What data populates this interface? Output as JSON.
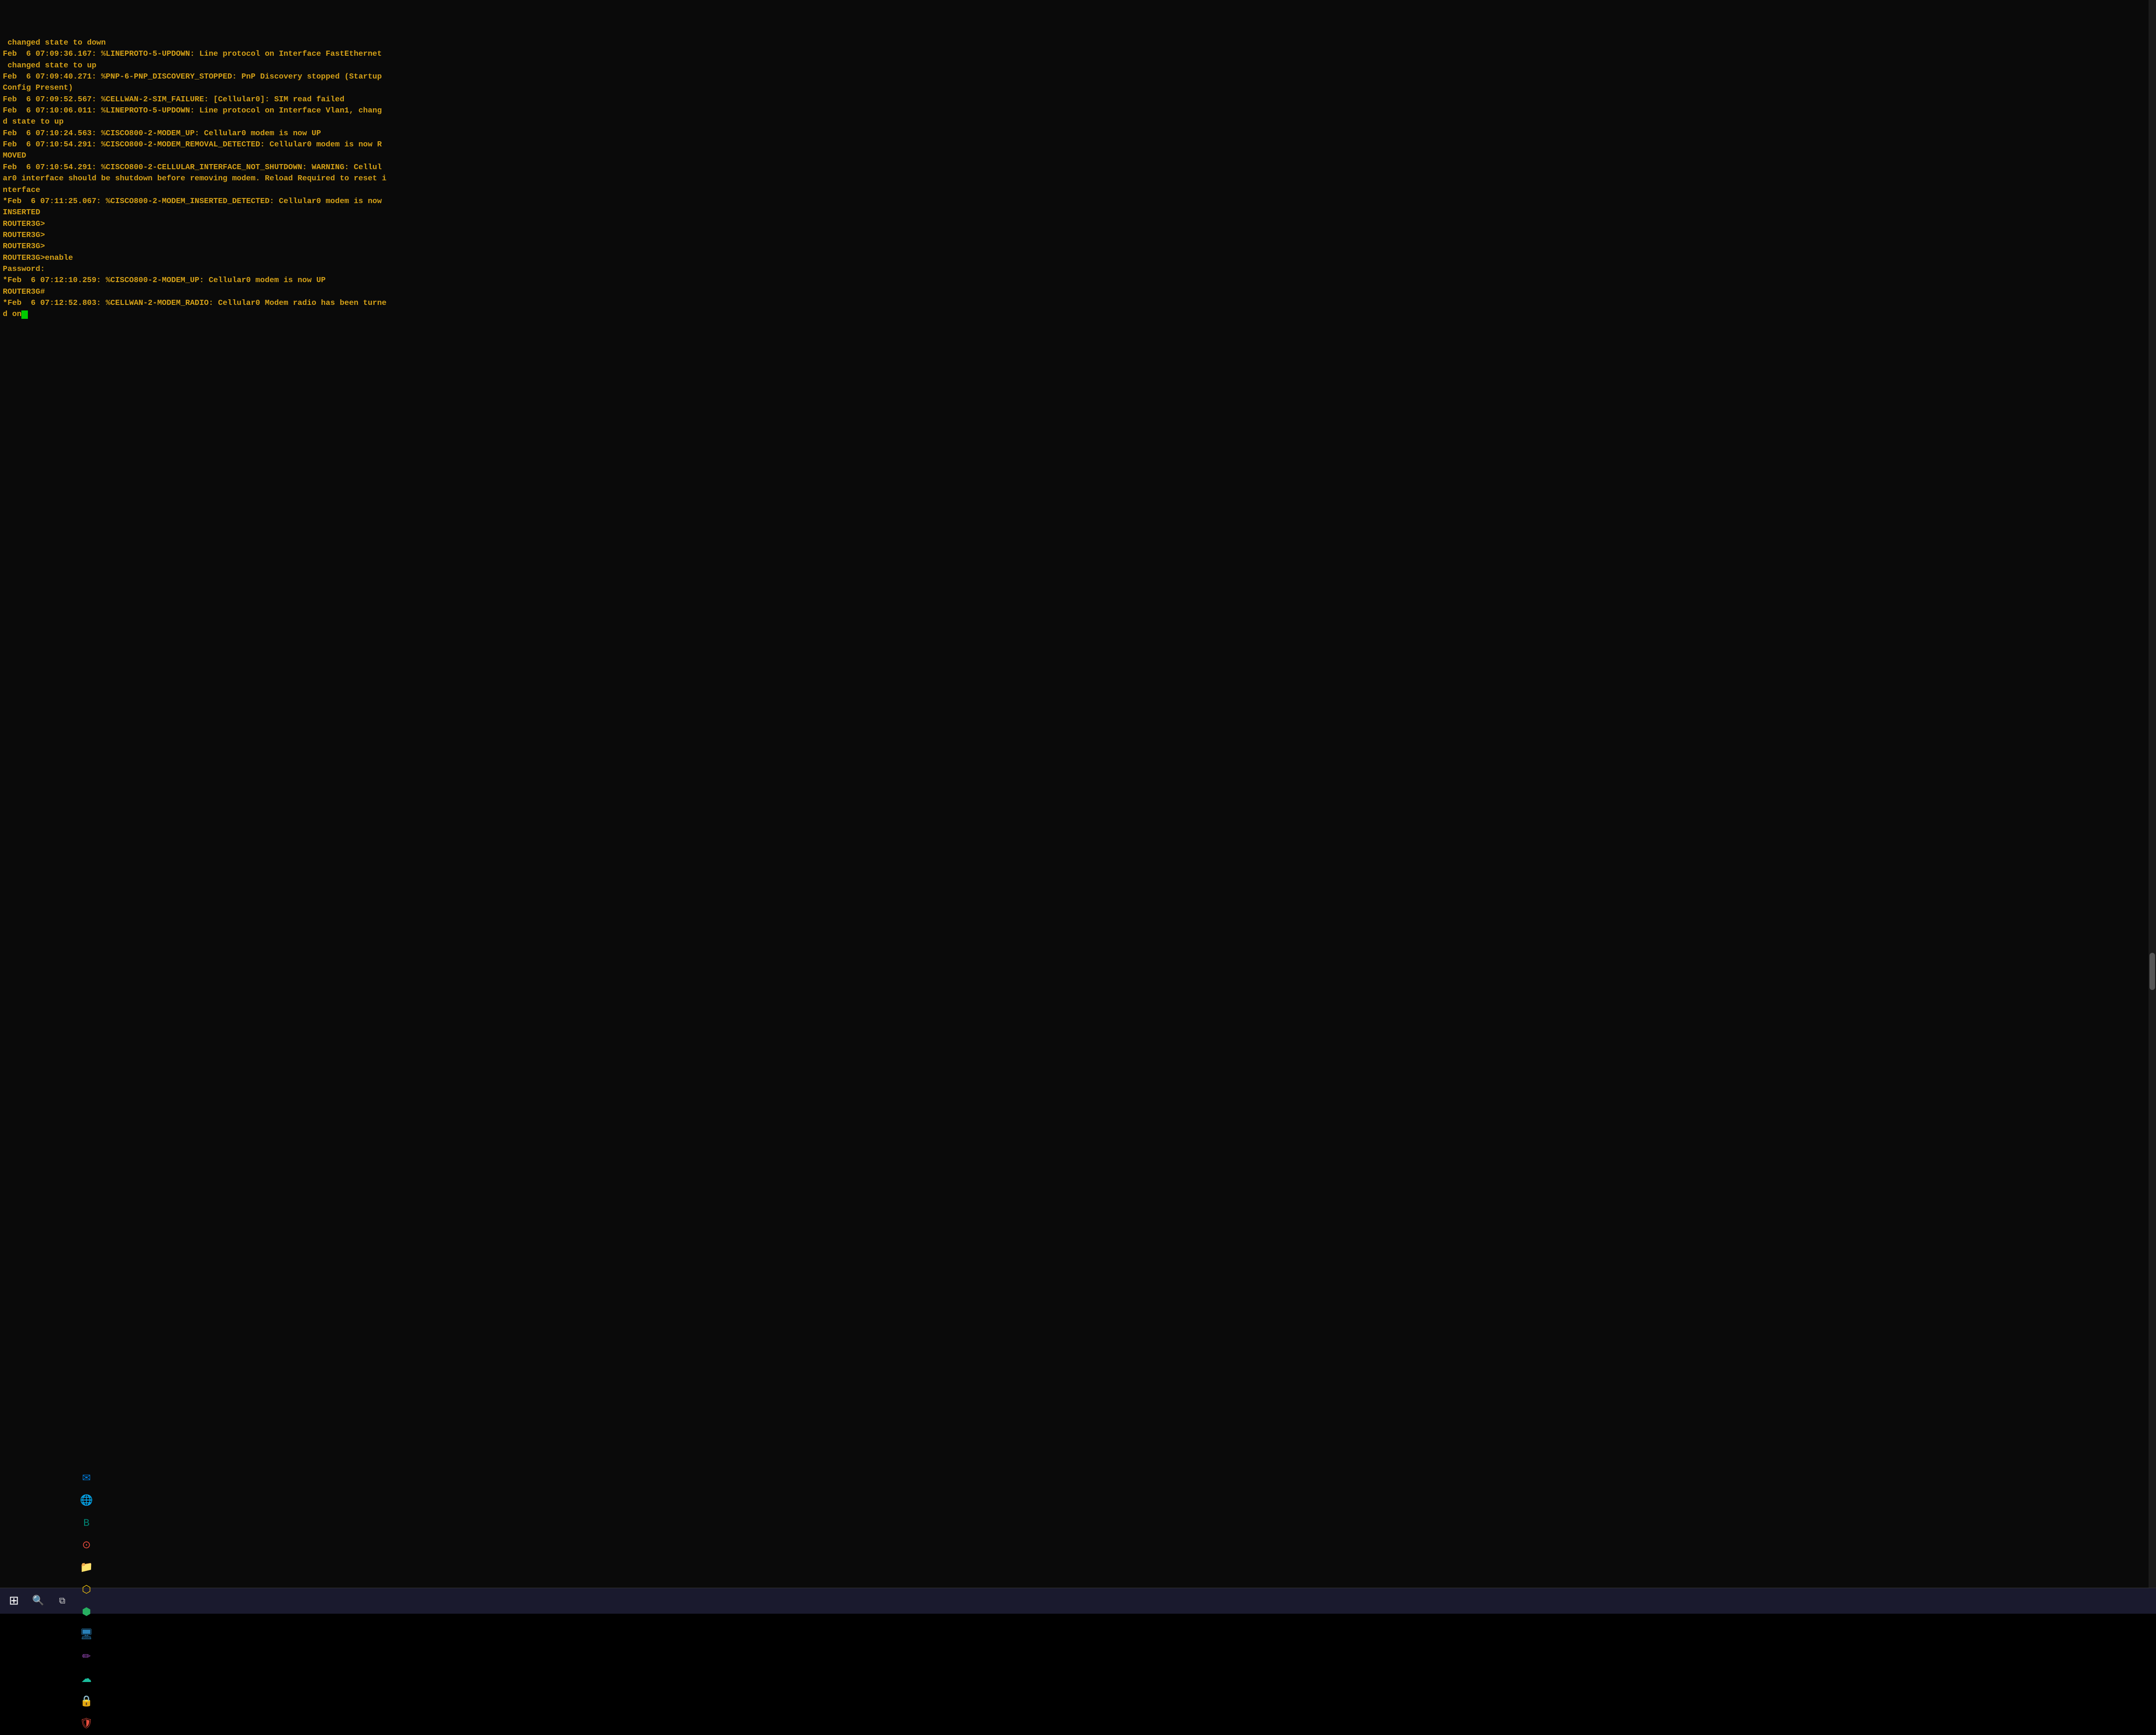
{
  "terminal": {
    "lines": [
      " changed state to down",
      "Feb  6 07:09:36.167: %LINEPROTO-5-UPDOWN: Line protocol on Interface FastEthernet",
      " changed state to up",
      "Feb  6 07:09:40.271: %PNP-6-PNP_DISCOVERY_STOPPED: PnP Discovery stopped (Startup",
      "Config Present)",
      "Feb  6 07:09:52.567: %CELLWAN-2-SIM_FAILURE: [Cellular0]: SIM read failed",
      "Feb  6 07:10:06.011: %LINEPROTO-5-UPDOWN: Line protocol on Interface Vlan1, chang",
      "d state to up",
      "Feb  6 07:10:24.563: %CISCO800-2-MODEM_UP: Cellular0 modem is now UP",
      "Feb  6 07:10:54.291: %CISCO800-2-MODEM_REMOVAL_DETECTED: Cellular0 modem is now R",
      "MOVED",
      "Feb  6 07:10:54.291: %CISCO800-2-CELLULAR_INTERFACE_NOT_SHUTDOWN: WARNING: Cellul",
      "ar0 interface should be shutdown before removing modem. Reload Required to reset i",
      "nterface",
      "*Feb  6 07:11:25.067: %CISCO800-2-MODEM_INSERTED_DETECTED: Cellular0 modem is now",
      "INSERTED",
      "ROUTER3G>",
      "ROUTER3G>",
      "ROUTER3G>",
      "ROUTER3G>enable",
      "Password:",
      "*Feb  6 07:12:10.259: %CISCO800-2-MODEM_UP: Cellular0 modem is now UP",
      "ROUTER3G#",
      "*Feb  6 07:12:52.803: %CELLWAN-2-MODEM_RADIO: Cellular0 Modem radio has been turne",
      "d on"
    ],
    "cursor_line": 24,
    "cursor_after": "d on"
  },
  "taskbar": {
    "start_label": "⊞",
    "search_label": "🔍",
    "taskview_label": "❑",
    "icons": [
      {
        "name": "outlook",
        "symbol": "✉",
        "class": "tb-outlook",
        "label": "Outlook"
      },
      {
        "name": "edge",
        "symbol": "🌐",
        "class": "tb-edge",
        "label": "Edge"
      },
      {
        "name": "bing",
        "symbol": "B",
        "class": "tb-bing",
        "label": "Bing"
      },
      {
        "name": "chrome",
        "symbol": "⊙",
        "class": "tb-chrome",
        "label": "Chrome"
      },
      {
        "name": "files",
        "symbol": "📁",
        "class": "tb-files",
        "label": "Files"
      },
      {
        "name": "app-yellow",
        "symbol": "⬡",
        "class": "tb-yellow",
        "label": "App"
      },
      {
        "name": "app-green2",
        "symbol": "⬢",
        "class": "tb-green2",
        "label": "App2"
      },
      {
        "name": "remote",
        "symbol": "🖥",
        "class": "tb-remote",
        "label": "Remote"
      },
      {
        "name": "pen",
        "symbol": "✏",
        "class": "tb-pen",
        "label": "Pen"
      },
      {
        "name": "cisco",
        "symbol": "☁",
        "class": "tb-cisco",
        "label": "Cisco"
      },
      {
        "name": "greenlock",
        "symbol": "🔒",
        "class": "tb-greenlock",
        "label": "Lock"
      },
      {
        "name": "redapp",
        "symbol": "🛡",
        "class": "tb-red",
        "label": "Security"
      }
    ]
  }
}
